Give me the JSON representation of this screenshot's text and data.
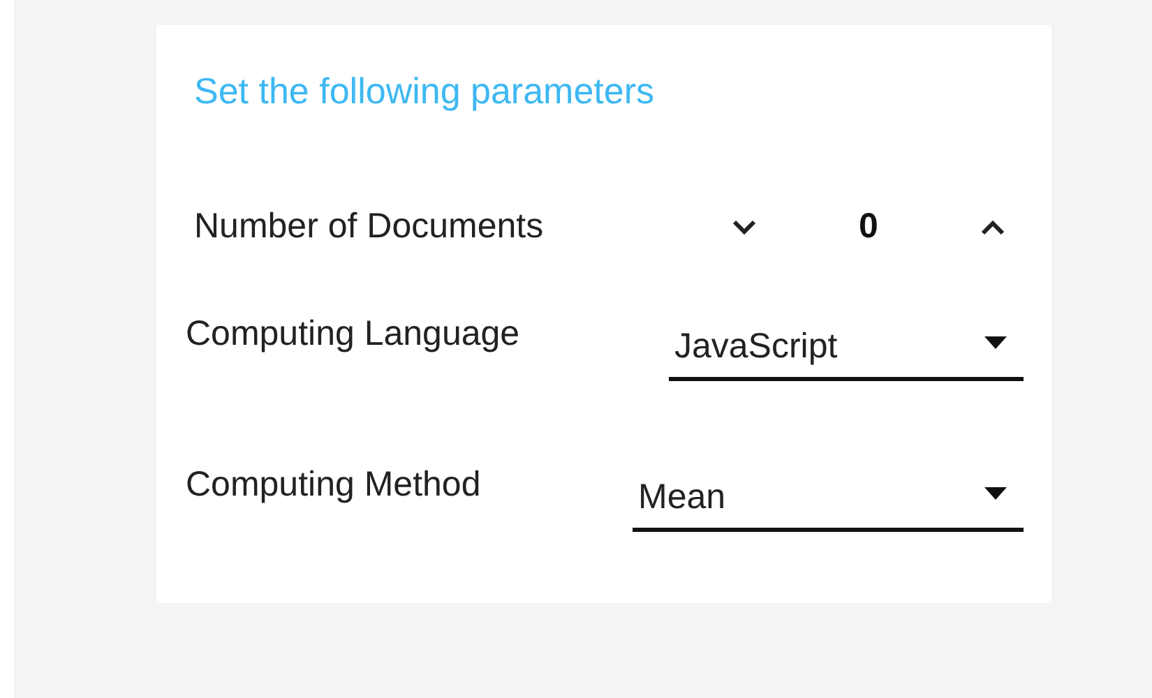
{
  "title": "Set the following parameters",
  "counter": {
    "label": "Number of Documents",
    "value": "0"
  },
  "selects": [
    {
      "label": "Computing Language",
      "value": "JavaScript"
    },
    {
      "label": "Computing Method",
      "value": "Mean"
    }
  ]
}
